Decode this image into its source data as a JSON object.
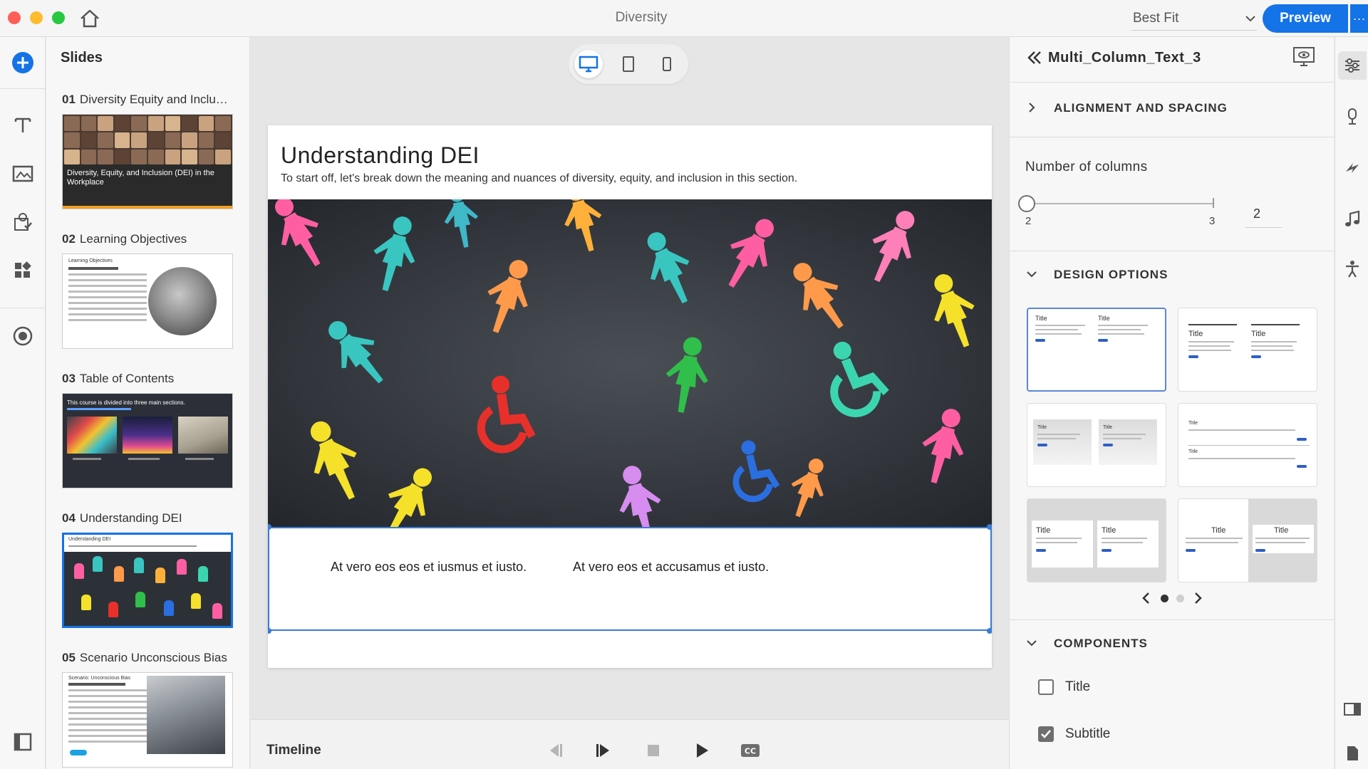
{
  "window": {
    "title": "Diversity",
    "zoom_select": "Best Fit",
    "preview_label": "Preview",
    "preview_more": "···"
  },
  "slides_panel": {
    "title": "Slides",
    "slides": [
      {
        "number": "01",
        "title": "Diversity Equity and Inclusi...",
        "thumb_caption": "Diversity, Equity, and Inclusion (DEI) in the Workplace"
      },
      {
        "number": "02",
        "title": "Learning Objectives",
        "thumb_caption": "Learning Objectives"
      },
      {
        "number": "03",
        "title": "Table of Contents",
        "thumb_caption": "This course is divided into three main sections."
      },
      {
        "number": "04",
        "title": "Understanding DEI",
        "thumb_caption": "Understanding DEI"
      },
      {
        "number": "05",
        "title": "Scenario Unconscious Bias",
        "thumb_caption": "Scenario: Unconscious Bias"
      }
    ]
  },
  "slide": {
    "heading": "Understanding DEI",
    "subheading": "To start off, let's break down the meaning and nuances of diversity, equity, and inclusion in this section.",
    "column_1": "At vero eos eos et iusmus et iusto.",
    "column_2": "At vero eos et accusamus et iusto."
  },
  "timeline": {
    "label": "Timeline"
  },
  "properties": {
    "component_name": "Multi_Column_Text_3",
    "alignment_section": "ALIGNMENT AND SPACING",
    "columns_label": "Number of columns",
    "slider_min": "2",
    "slider_max": "3",
    "columns_value": "2",
    "design_section": "DESIGN OPTIONS",
    "design_card_title": "Title",
    "components_section": "COMPONENTS",
    "components": [
      {
        "label": "Title",
        "checked": false
      },
      {
        "label": "Subtitle",
        "checked": true
      }
    ]
  },
  "colors": {
    "accent": "#1473e6",
    "selection": "#3b7bd4",
    "panel": "#f7f7f7"
  }
}
